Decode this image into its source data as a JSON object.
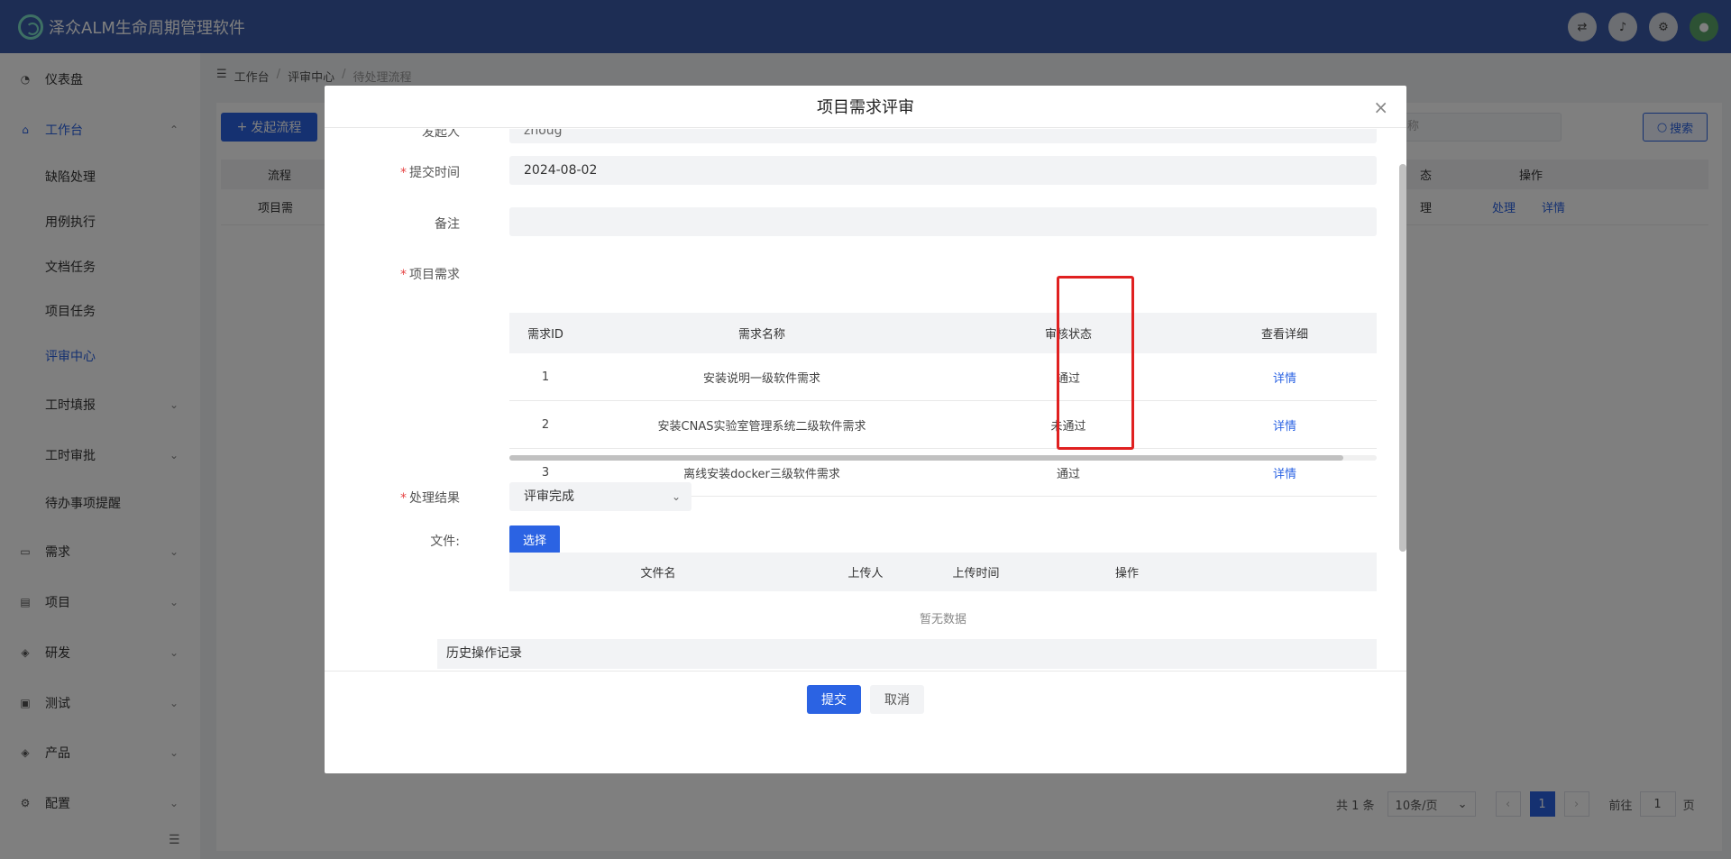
{
  "app": {
    "title": "泽众ALM生命周期管理软件",
    "brand_color": "#3a5ba8",
    "accent_color": "#2b63e3",
    "header_icons": [
      "translate-icon",
      "bell-icon",
      "gear-icon",
      "avatar"
    ]
  },
  "sidebar": {
    "items": [
      {
        "label": "仪表盘",
        "icon": "dashboard-icon"
      },
      {
        "label": "工作台",
        "icon": "home-icon",
        "expanded": true
      },
      {
        "label": "缺陷处理"
      },
      {
        "label": "用例执行"
      },
      {
        "label": "文档任务"
      },
      {
        "label": "项目任务"
      },
      {
        "label": "评审中心",
        "active": true
      },
      {
        "label": "工时填报"
      },
      {
        "label": "工时审批"
      },
      {
        "label": "待办事项提醒"
      },
      {
        "label": "需求",
        "icon": "chat-icon"
      },
      {
        "label": "项目",
        "icon": "database-icon"
      },
      {
        "label": "研发",
        "icon": "layers-icon"
      },
      {
        "label": "测试",
        "icon": "clipboard-icon"
      },
      {
        "label": "产品",
        "icon": "stack-icon"
      },
      {
        "label": "配置",
        "icon": "gear-icon"
      }
    ]
  },
  "breadcrumb": [
    "工作台",
    "评审中心",
    "待处理流程"
  ],
  "background_page": {
    "start_flow_button": "发起流程",
    "search_placeholder": "称",
    "search_button": "搜索",
    "table_headers": {
      "flow": "流程",
      "status": "态",
      "action": "操作"
    },
    "row": {
      "flow": "项目需",
      "status": "理",
      "action_handle": "处理",
      "action_detail": "详情"
    },
    "pager": {
      "total": "共 1 条",
      "page_size": "10条/页",
      "prev": "‹",
      "current": "1",
      "next": "›",
      "goto_label": "前往",
      "goto_value": "1",
      "goto_unit": "页"
    }
  },
  "modal": {
    "title": "项目需求评审",
    "fields": {
      "initiator_label": "发起人",
      "initiator_value": "zhoug",
      "submit_time_label": "提交时间",
      "submit_time_value": "2024-08-02",
      "remark_label": "备注",
      "remark_value": "",
      "requirements_label": "项目需求",
      "result_label": "处理结果",
      "result_value": "评审完成",
      "file_label": "文件:"
    },
    "requirements_table": {
      "headers": [
        "需求ID",
        "需求名称",
        "审核状态",
        "查看详细"
      ],
      "rows": [
        {
          "id": "1",
          "name": "安装说明一级软件需求",
          "status": "通过",
          "detail": "详情"
        },
        {
          "id": "2",
          "name": "安装CNAS实验室管理系统二级软件需求",
          "status": "未通过",
          "detail": "详情"
        },
        {
          "id": "3",
          "name": "离线安装docker三级软件需求",
          "status": "通过",
          "detail": "详情"
        }
      ]
    },
    "choose_button": "选择",
    "file_table": {
      "headers": [
        "文件名",
        "上传人",
        "上传时间",
        "操作"
      ],
      "empty_text": "暂无数据"
    },
    "history_title": "历史操作记录",
    "submit_button": "提交",
    "cancel_button": "取消",
    "highlight_color": "#e02020"
  }
}
